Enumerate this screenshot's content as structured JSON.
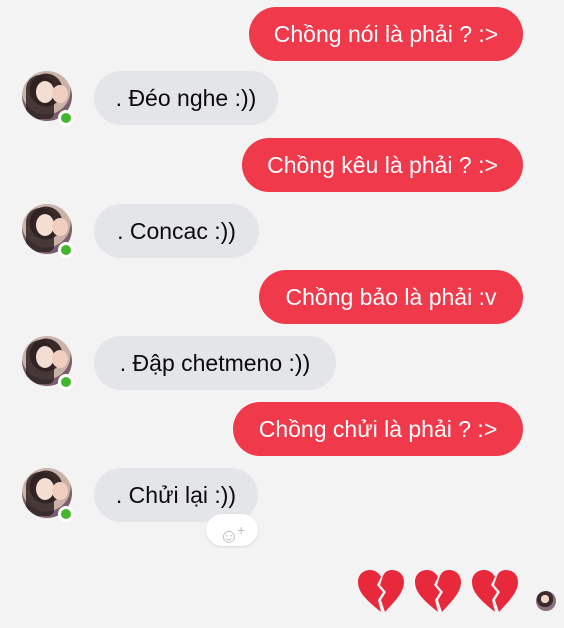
{
  "messages": [
    {
      "side": "sent",
      "text": "Chồng nói là phải ? :>"
    },
    {
      "side": "received",
      "text": ". Đéo nghe :))"
    },
    {
      "side": "sent",
      "text": "Chồng kêu là phải ? :>"
    },
    {
      "side": "received",
      "text": ". Concac :))"
    },
    {
      "side": "sent",
      "text": "Chồng bảo là phải :v"
    },
    {
      "side": "received",
      "text": ". Đập chetmeno :))"
    },
    {
      "side": "sent",
      "text": "Chồng chửi là phải ? :>"
    },
    {
      "side": "received",
      "text": ". Chửi lại :))"
    }
  ],
  "reaction_button": {
    "icon": "smiley-add-icon",
    "glyph": "☺",
    "plus": "+"
  },
  "last_sent": {
    "emoji": "broken-heart-icon",
    "count": 3
  },
  "colors": {
    "sent_bubble": "#f03a4c",
    "received_bubble": "#e4e5e9",
    "online_dot": "#42b72a",
    "heart": "#e8293b"
  }
}
